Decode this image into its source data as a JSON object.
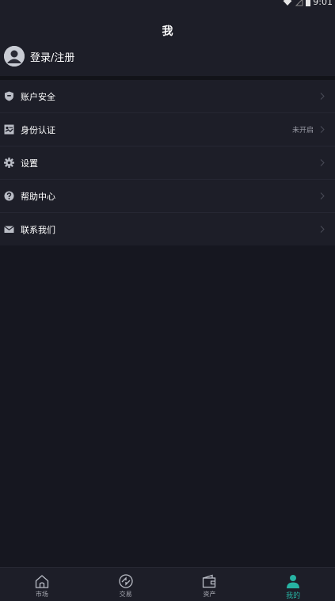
{
  "status_bar": {
    "time": "9:01"
  },
  "header": {
    "title": "我",
    "login_label": "登录/注册"
  },
  "menu": {
    "items": [
      {
        "label": "账户安全",
        "status": "",
        "icon": "shield-icon"
      },
      {
        "label": "身份认证",
        "status": "未开启",
        "icon": "id-card-icon"
      },
      {
        "label": "设置",
        "status": "",
        "icon": "gear-icon"
      },
      {
        "label": "帮助中心",
        "status": "",
        "icon": "help-icon"
      },
      {
        "label": "联系我们",
        "status": "",
        "icon": "mail-icon"
      }
    ]
  },
  "bottom_nav": {
    "items": [
      {
        "label": "市场",
        "icon": "home-icon",
        "active": false
      },
      {
        "label": "交易",
        "icon": "exchange-icon",
        "active": false
      },
      {
        "label": "资产",
        "icon": "wallet-icon",
        "active": false
      },
      {
        "label": "我的",
        "icon": "person-icon",
        "active": true
      }
    ]
  },
  "colors": {
    "background": "#161720",
    "panel": "#1d1e28",
    "accent": "#27b3a3",
    "icon_gray": "#b9bcc5",
    "muted_text": "#9a9ca6"
  }
}
